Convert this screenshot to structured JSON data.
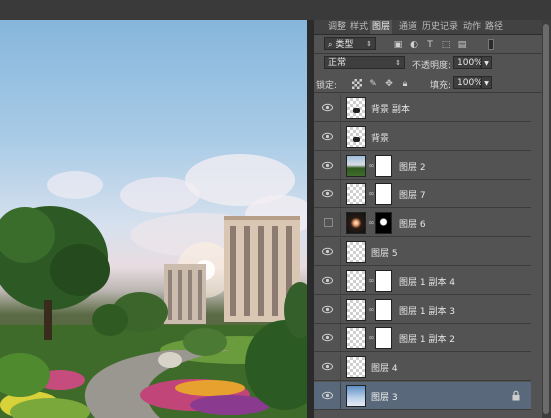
{
  "panel_tabs": [
    "调整",
    "样式",
    "图层",
    "通道",
    "历史记录",
    "动作",
    "路径"
  ],
  "active_tab": "图层",
  "filter": {
    "kind_label": "类型",
    "icons": [
      "image-filter-icon",
      "adjustment-filter-icon",
      "type-filter-icon",
      "shape-filter-icon",
      "smart-object-filter-icon",
      "filter-toggle-icon"
    ]
  },
  "blend": {
    "mode": "正常",
    "opacity_label": "不透明度:",
    "opacity_value": "100%"
  },
  "lock": {
    "label": "锁定:",
    "fill_label": "填充:",
    "fill_value": "100%",
    "icons": [
      "lock-transparent-icon",
      "lock-image-icon",
      "lock-position-icon",
      "lock-all-icon"
    ]
  },
  "layers": [
    {
      "name": "背景 副本",
      "visible": true,
      "thumb": "dark-dot",
      "mask": false,
      "selected": false,
      "locked": false
    },
    {
      "name": "背景",
      "visible": true,
      "thumb": "dark-dot",
      "mask": false,
      "selected": false,
      "locked": false
    },
    {
      "name": "图层 2",
      "visible": true,
      "thumb": "landscape",
      "mask": true,
      "selected": false,
      "locked": false
    },
    {
      "name": "图层 7",
      "visible": true,
      "thumb": "empty",
      "mask": true,
      "selected": false,
      "locked": false
    },
    {
      "name": "图层 6",
      "visible": false,
      "thumb": "glow",
      "mask": true,
      "selected": false,
      "locked": false
    },
    {
      "name": "图层 5",
      "visible": true,
      "thumb": "empty",
      "mask": false,
      "selected": false,
      "locked": false
    },
    {
      "name": "图层 1 副本 4",
      "visible": true,
      "thumb": "empty",
      "mask": true,
      "selected": false,
      "locked": false
    },
    {
      "name": "图层 1 副本 3",
      "visible": true,
      "thumb": "empty",
      "mask": true,
      "selected": false,
      "locked": false
    },
    {
      "name": "图层 1 副本 2",
      "visible": true,
      "thumb": "empty",
      "mask": true,
      "selected": false,
      "locked": false
    },
    {
      "name": "图层 4",
      "visible": true,
      "thumb": "empty",
      "mask": false,
      "selected": false,
      "locked": false
    },
    {
      "name": "图层 3",
      "visible": true,
      "thumb": "sky",
      "mask": false,
      "selected": true,
      "locked": true
    }
  ]
}
